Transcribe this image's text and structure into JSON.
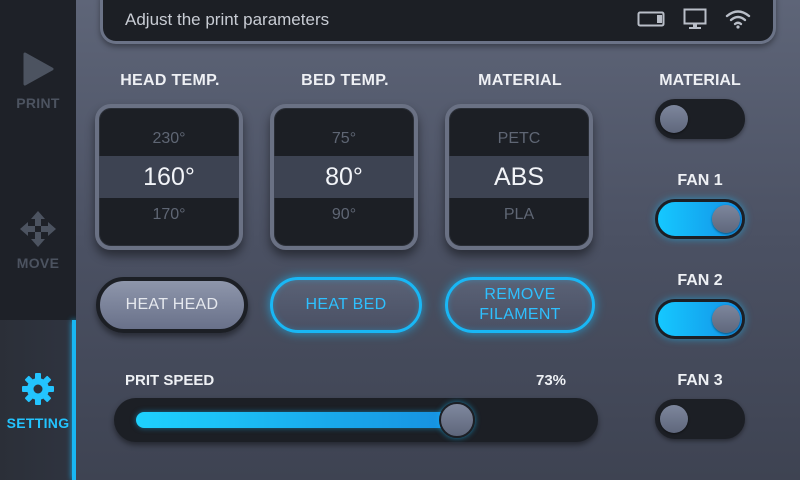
{
  "status_bar": {
    "title": "Adjust the print parameters",
    "icons": [
      "card-reader-icon",
      "monitor-icon",
      "wifi-icon"
    ]
  },
  "sidebar": {
    "items": [
      {
        "label": "PRINT",
        "icon": "play-icon",
        "active": false
      },
      {
        "label": "MOVE",
        "icon": "move-arrows-icon",
        "active": false
      },
      {
        "label": "SETTING",
        "icon": "gear-icon",
        "active": true
      }
    ]
  },
  "pickers": {
    "head": {
      "label": "HEAD TEMP.",
      "above": "230°",
      "selected": "160°",
      "below": "170°"
    },
    "bed": {
      "label": "BED TEMP.",
      "above": "75°",
      "selected": "80°",
      "below": "90°"
    },
    "material": {
      "label": "MATERIAL",
      "above": "PETC",
      "selected": "ABS",
      "below": "PLA"
    }
  },
  "buttons": {
    "heat_head": "HEAT HEAD",
    "heat_bed": "HEAT BED",
    "remove_filament": "REMOVE FILAMENT"
  },
  "toggles": {
    "material": {
      "label": "MATERIAL",
      "on": false
    },
    "fan1": {
      "label": "FAN 1",
      "on": true
    },
    "fan2": {
      "label": "FAN 2",
      "on": true
    },
    "fan3": {
      "label": "FAN 3",
      "on": false
    }
  },
  "speed": {
    "label": "PRIT SPEED",
    "value_text": "73%",
    "value": 0.73
  },
  "colors": {
    "accent": "#19b7f5",
    "panel_dark": "#1c1f25"
  }
}
